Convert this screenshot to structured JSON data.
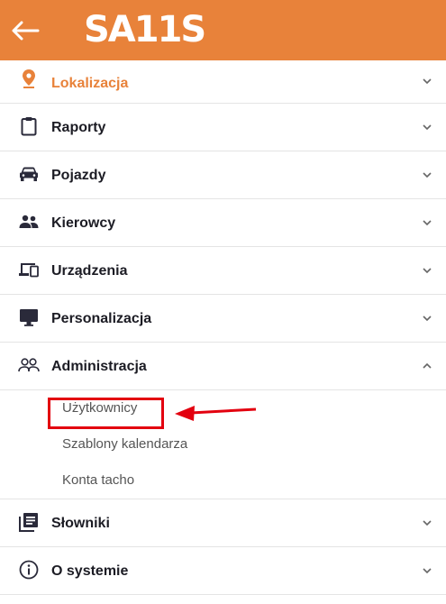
{
  "header": {
    "logo": "SA11S",
    "back_icon": "arrow-left-icon",
    "background": "#e8823a"
  },
  "menu": {
    "items": [
      {
        "label": "Lokalizacja",
        "icon": "location-pin-icon",
        "active": true
      },
      {
        "label": "Raporty",
        "icon": "clipboard-icon"
      },
      {
        "label": "Pojazdy",
        "icon": "car-icon"
      },
      {
        "label": "Kierowcy",
        "icon": "people-icon"
      },
      {
        "label": "Urządzenia",
        "icon": "devices-icon"
      },
      {
        "label": "Personalizacja",
        "icon": "monitor-icon"
      },
      {
        "label": "Administracja",
        "icon": "people-outline-icon",
        "expanded": true
      }
    ],
    "admin_sub": [
      {
        "label": "Użytkownicy"
      },
      {
        "label": "Szablony kalendarza"
      },
      {
        "label": "Konta tacho"
      }
    ],
    "items_after": [
      {
        "label": "Słowniki",
        "icon": "library-books-icon"
      },
      {
        "label": "O systemie",
        "icon": "info-icon"
      }
    ]
  },
  "colors": {
    "accent": "#e8823a",
    "highlight": "#e3000f",
    "text": "#1c1c24"
  }
}
